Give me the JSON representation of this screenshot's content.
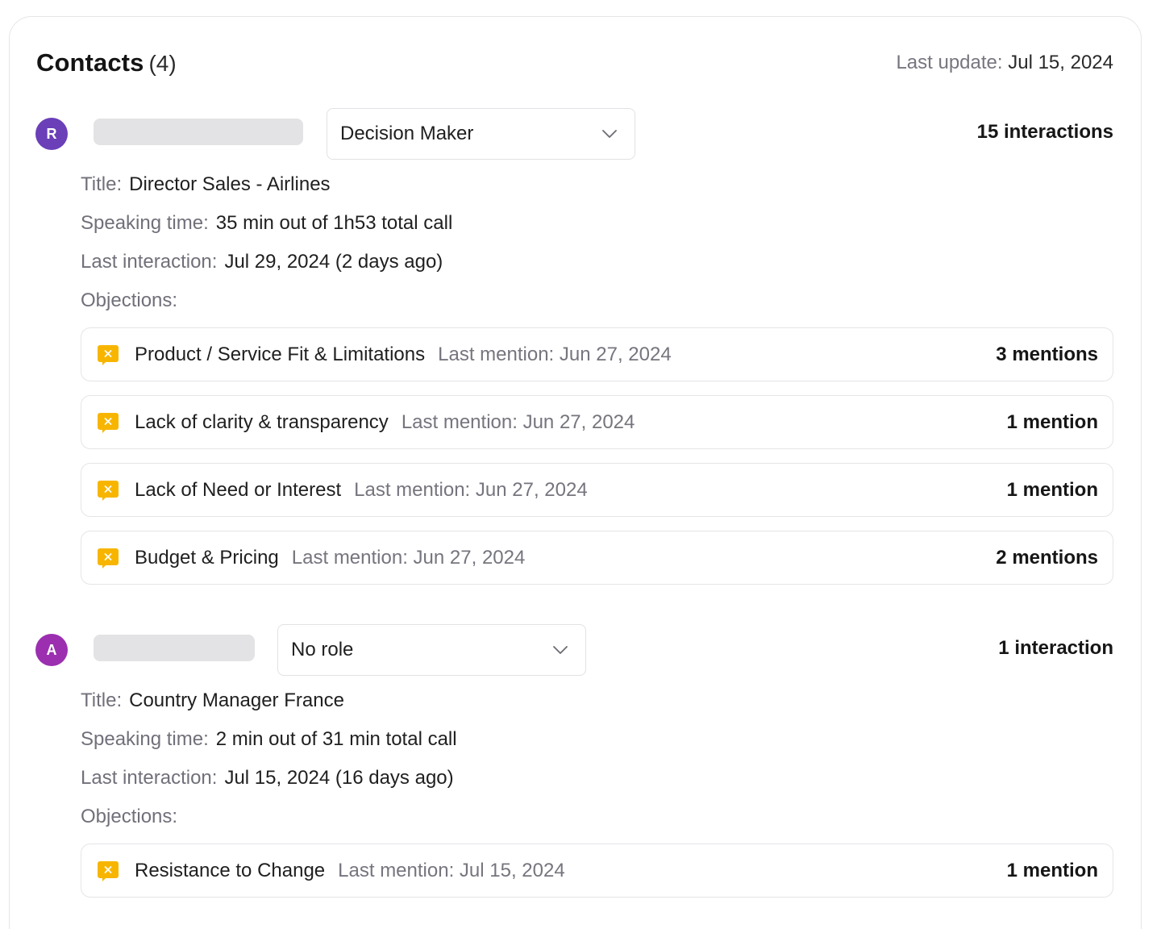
{
  "header": {
    "title": "Contacts",
    "count": "(4)",
    "last_update_label": "Last update:",
    "last_update_value": "Jul 15, 2024"
  },
  "labels": {
    "title": "Title:",
    "speaking_time": "Speaking time:",
    "last_interaction": "Last interaction:",
    "objections": "Objections:",
    "last_mention": "Last mention:"
  },
  "contacts": [
    {
      "initial": "R",
      "avatar_color": "#6a3fb8",
      "role": "Decision Maker",
      "interactions": "15 interactions",
      "title": "Director Sales - Airlines",
      "speaking_time": "35 min out of 1h53 total call",
      "last_interaction": "Jul 29, 2024 (2 days ago)",
      "objections": [
        {
          "name": "Product / Service Fit & Limitations",
          "last_mention": "Jun 27, 2024",
          "mentions": "3 mentions"
        },
        {
          "name": "Lack of clarity & transparency",
          "last_mention": "Jun 27, 2024",
          "mentions": "1 mention"
        },
        {
          "name": "Lack of Need or Interest",
          "last_mention": "Jun 27, 2024",
          "mentions": "1 mention"
        },
        {
          "name": "Budget & Pricing",
          "last_mention": "Jun 27, 2024",
          "mentions": "2 mentions"
        }
      ]
    },
    {
      "initial": "A",
      "avatar_color": "#9b2fb0",
      "role": "No role",
      "interactions": "1 interaction",
      "title": "Country Manager France",
      "speaking_time": "2 min out of 31 min total call",
      "last_interaction": "Jul 15, 2024 (16 days ago)",
      "objections": [
        {
          "name": "Resistance to Change",
          "last_mention": "Jul 15, 2024",
          "mentions": "1 mention"
        }
      ]
    }
  ],
  "colors": {
    "objection_icon": "#f7b500"
  },
  "icons": {
    "objection": "objection-x-bubble-icon",
    "dropdown": "chevron-down-icon"
  }
}
